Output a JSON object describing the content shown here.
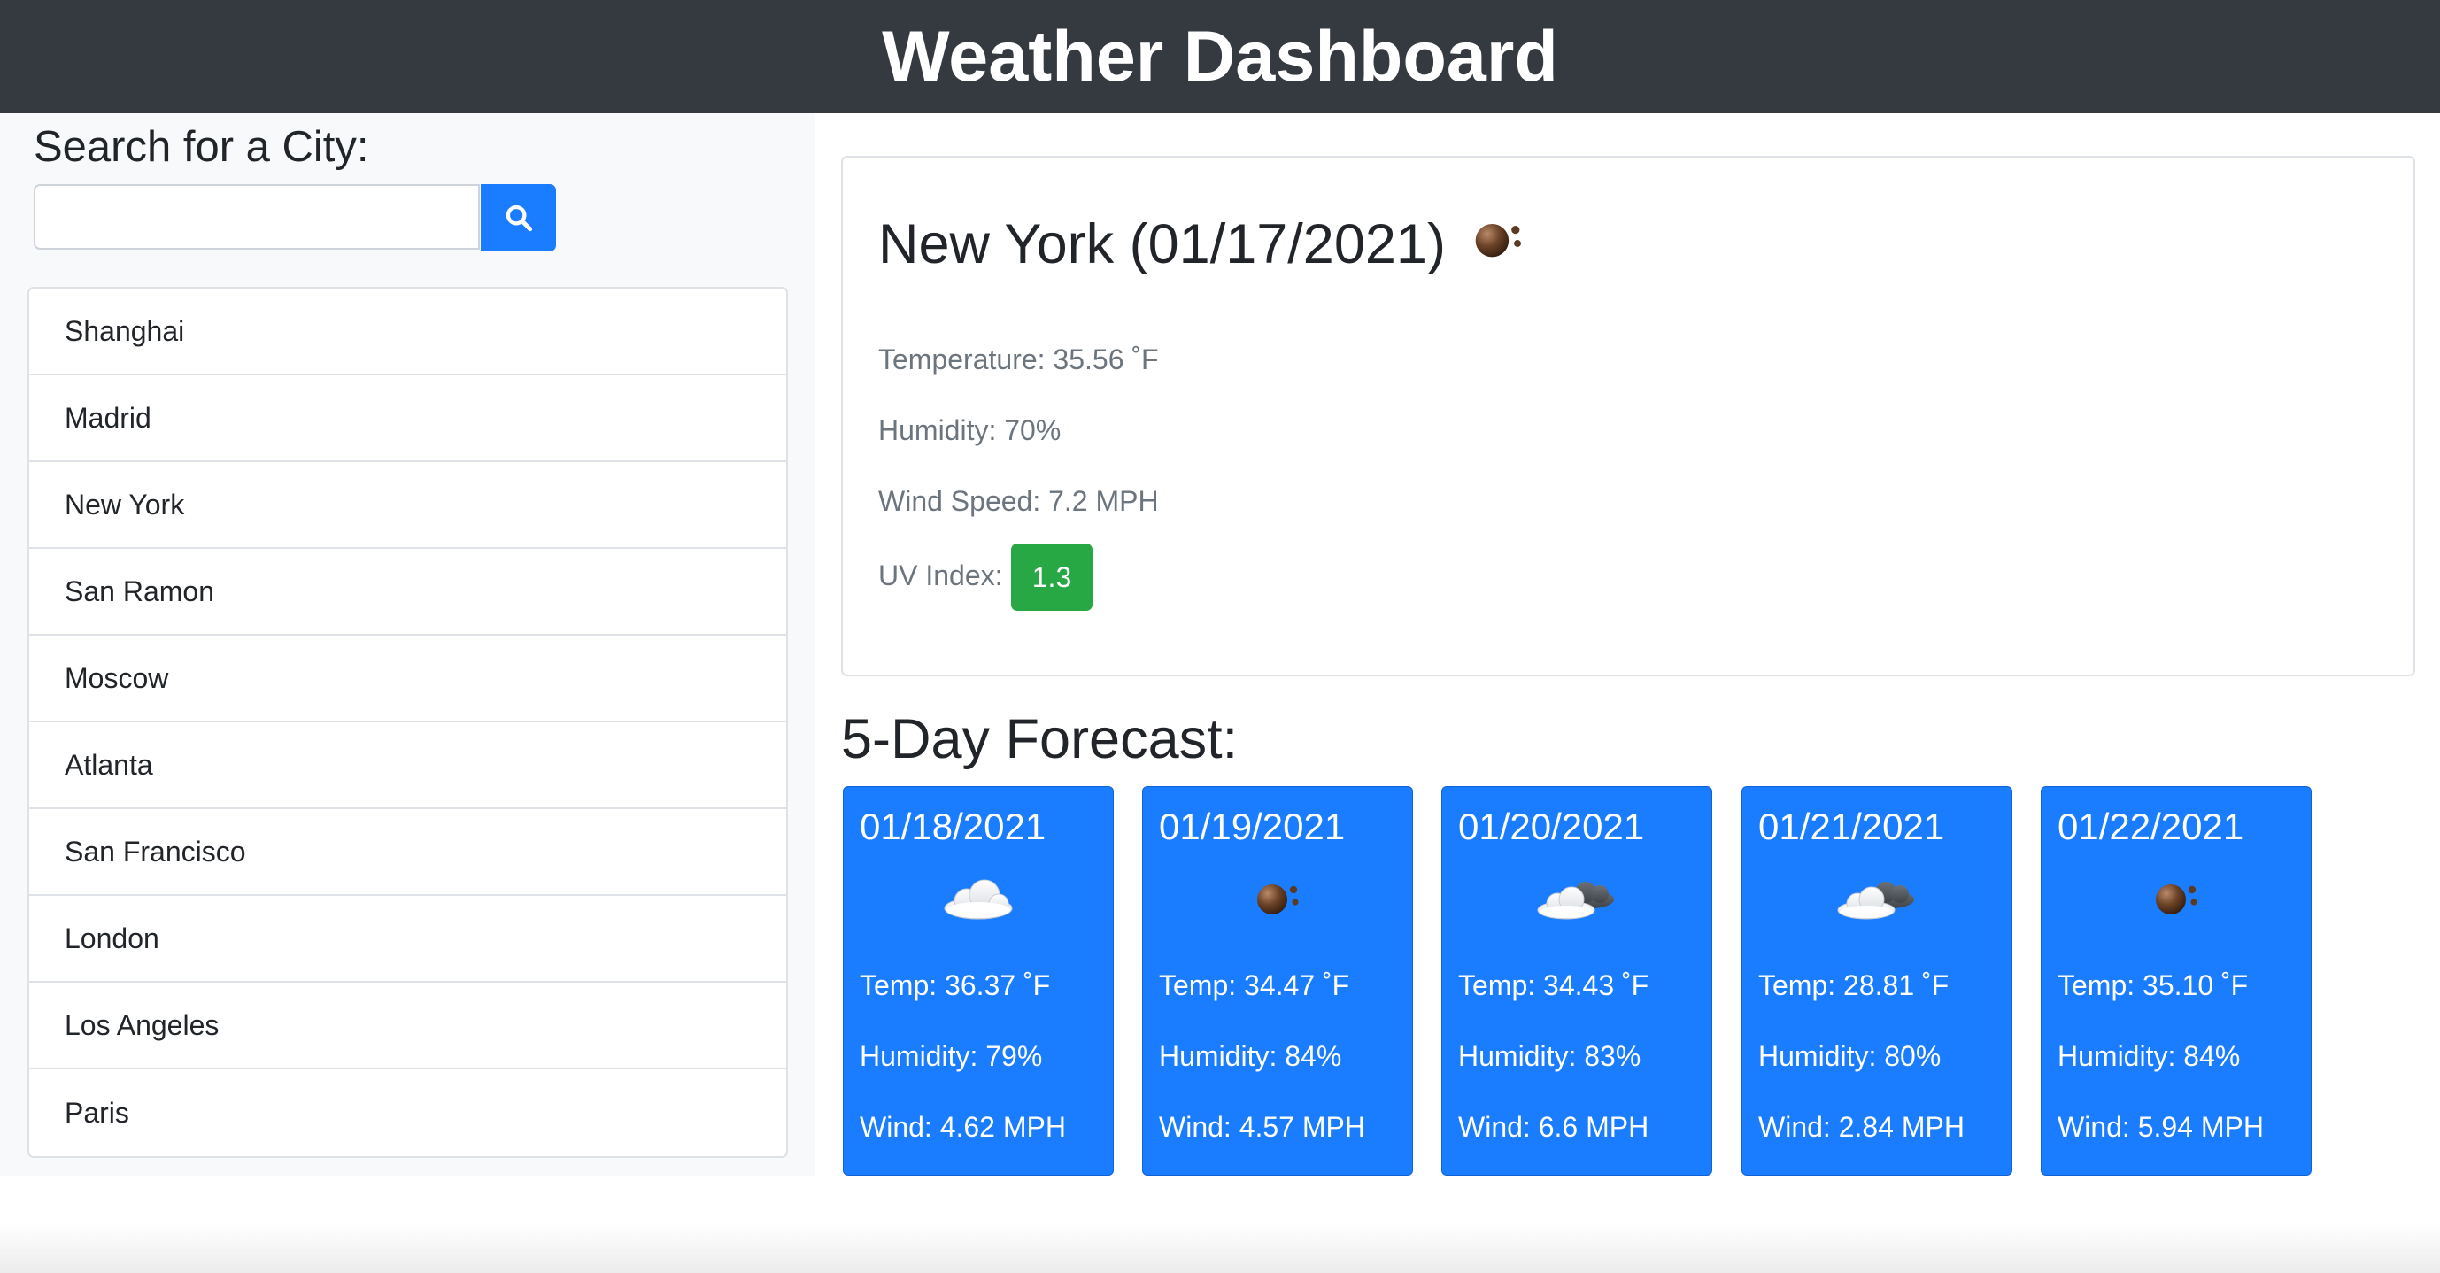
{
  "header": {
    "title": "Weather Dashboard"
  },
  "sidebar": {
    "search_label": "Search for a City:",
    "search_value": "",
    "search_placeholder": "",
    "search_button_icon": "search-icon",
    "cities": [
      "Shanghai",
      "Madrid",
      "New York",
      "San Ramon",
      "Moscow",
      "Atlanta",
      "San Francisco",
      "London",
      "Los Angeles",
      "Paris"
    ]
  },
  "current": {
    "title": "New York (01/17/2021)",
    "icon": "overcast-clouds-icon",
    "temperature": "Temperature: 35.56 ˚F",
    "humidity": "Humidity: 70%",
    "wind": "Wind Speed: 7.2 MPH",
    "uv_label": "UV Index:",
    "uv_value": "1.3",
    "uv_color": "#28a745"
  },
  "forecast": {
    "heading": "5-Day Forecast:",
    "days": [
      {
        "date": "01/18/2021",
        "icon": "cloud-icon",
        "temp": "Temp: 36.37 ˚F",
        "humidity": "Humidity: 79%",
        "wind": "Wind: 4.62 MPH"
      },
      {
        "date": "01/19/2021",
        "icon": "overcast-clouds-icon",
        "temp": "Temp: 34.47 ˚F",
        "humidity": "Humidity: 84%",
        "wind": "Wind: 4.57 MPH"
      },
      {
        "date": "01/20/2021",
        "icon": "broken-clouds-icon",
        "temp": "Temp: 34.43 ˚F",
        "humidity": "Humidity: 83%",
        "wind": "Wind: 6.6 MPH"
      },
      {
        "date": "01/21/2021",
        "icon": "broken-clouds-icon",
        "temp": "Temp: 28.81 ˚F",
        "humidity": "Humidity: 80%",
        "wind": "Wind: 2.84 MPH"
      },
      {
        "date": "01/22/2021",
        "icon": "overcast-clouds-icon",
        "temp": "Temp: 35.10 ˚F",
        "humidity": "Humidity: 84%",
        "wind": "Wind: 5.94 MPH"
      }
    ]
  },
  "colors": {
    "navbar": "#343a40",
    "accent": "#1a7cff",
    "uv_low": "#28a745",
    "sidebar_bg": "#f8f9fa"
  }
}
